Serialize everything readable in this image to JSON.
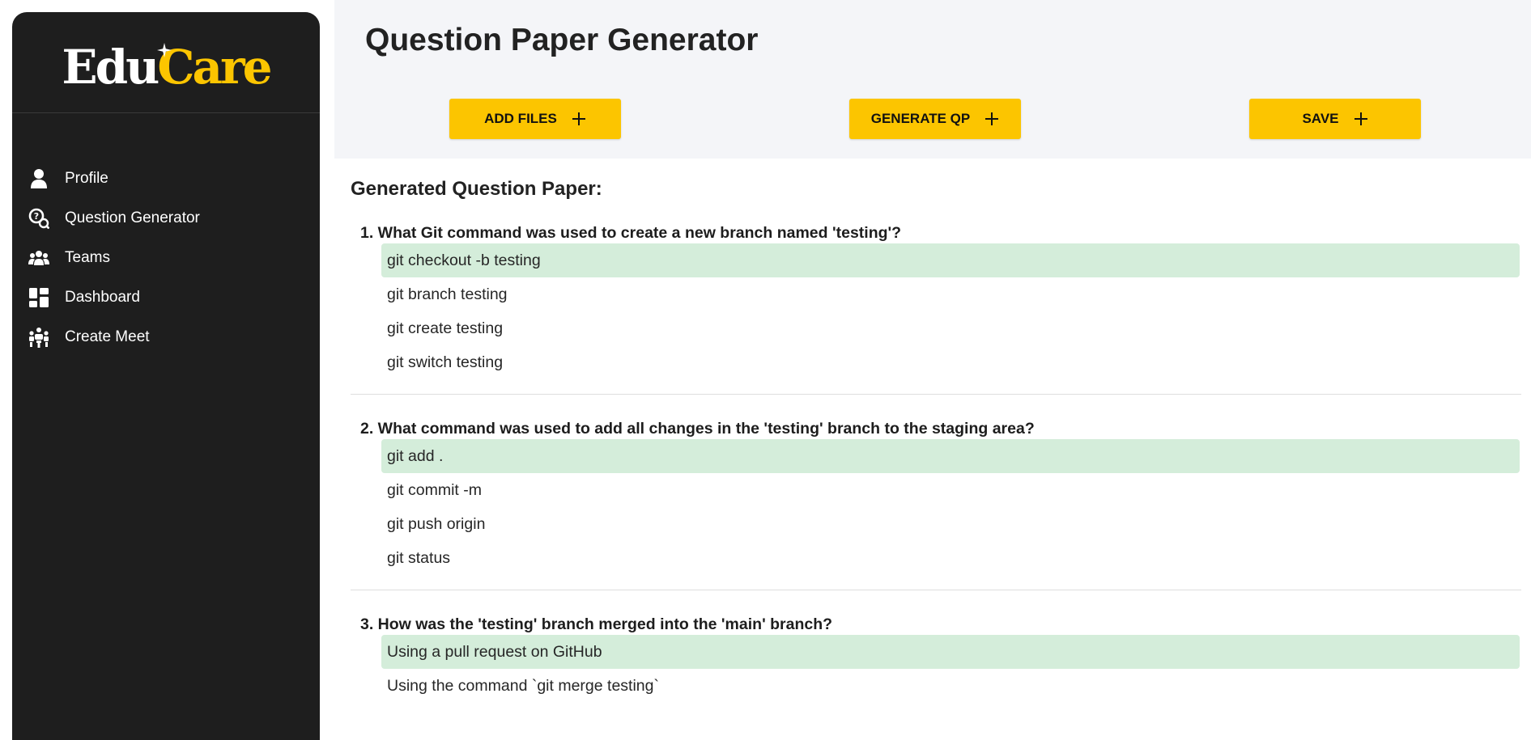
{
  "brand": {
    "part1": "Edu",
    "part2": "Care",
    "accent": "#fcc500"
  },
  "sidebar": {
    "items": [
      {
        "label": "Profile",
        "icon": "user-icon"
      },
      {
        "label": "Question Generator",
        "icon": "question-search-icon"
      },
      {
        "label": "Teams",
        "icon": "team-icon"
      },
      {
        "label": "Dashboard",
        "icon": "dashboard-icon"
      },
      {
        "label": "Create Meet",
        "icon": "meeting-icon"
      }
    ]
  },
  "header": {
    "title": "Question Paper Generator",
    "buttons": {
      "add_files": "ADD FILES",
      "generate_qp": "GENERATE QP",
      "save": "SAVE"
    }
  },
  "content": {
    "section_title": "Generated Question Paper:",
    "questions": [
      {
        "text": "1. What Git command was used to create a new branch named 'testing'?",
        "options": [
          "git checkout -b testing",
          "git branch testing",
          "git create testing",
          "git switch testing"
        ],
        "correct_index": 0
      },
      {
        "text": "2. What command was used to add all changes in the 'testing' branch to the staging area?",
        "options": [
          "git add .",
          "git commit -m",
          "git push origin",
          "git status"
        ],
        "correct_index": 0
      },
      {
        "text": "3. How was the 'testing' branch merged into the 'main' branch?",
        "options": [
          "Using a pull request on GitHub",
          "Using the command `git merge testing`"
        ],
        "correct_index": 0
      }
    ]
  },
  "colors": {
    "sidebar_bg": "#1e1e1e",
    "header_bg": "#f4f5f8",
    "button_bg": "#fcc500",
    "correct_bg": "#d4edda"
  }
}
